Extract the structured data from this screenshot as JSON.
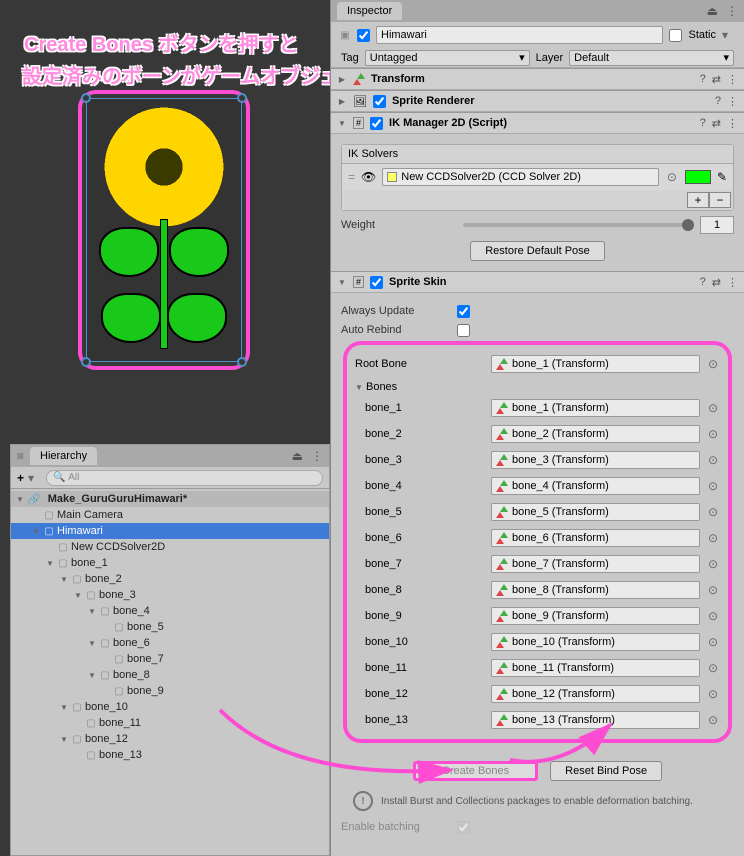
{
  "annot": {
    "line1": "Create Bones ボタンを押すと",
    "line2": "設定済みのボーンがゲームオブジェクトとして追加されました。"
  },
  "hierarchy": {
    "tab": "Hierarchy",
    "plus": "+",
    "search_placeholder": "All",
    "scene": "Make_GuruGuruHimawari*",
    "items": [
      {
        "name": "Main Camera",
        "indent": 1,
        "fold": ""
      },
      {
        "name": "Himawari",
        "indent": 1,
        "fold": "▼",
        "sel": true
      },
      {
        "name": "New CCDSolver2D",
        "indent": 2,
        "fold": ""
      },
      {
        "name": "bone_1",
        "indent": 2,
        "fold": "▼"
      },
      {
        "name": "bone_2",
        "indent": 3,
        "fold": "▼"
      },
      {
        "name": "bone_3",
        "indent": 4,
        "fold": "▼"
      },
      {
        "name": "bone_4",
        "indent": 5,
        "fold": "▼"
      },
      {
        "name": "bone_5",
        "indent": 6,
        "fold": ""
      },
      {
        "name": "bone_6",
        "indent": 5,
        "fold": "▼"
      },
      {
        "name": "bone_7",
        "indent": 6,
        "fold": ""
      },
      {
        "name": "bone_8",
        "indent": 5,
        "fold": "▼"
      },
      {
        "name": "bone_9",
        "indent": 6,
        "fold": ""
      },
      {
        "name": "bone_10",
        "indent": 3,
        "fold": "▼"
      },
      {
        "name": "bone_11",
        "indent": 4,
        "fold": ""
      },
      {
        "name": "bone_12",
        "indent": 3,
        "fold": "▼"
      },
      {
        "name": "bone_13",
        "indent": 4,
        "fold": ""
      }
    ]
  },
  "inspector": {
    "tab": "Inspector",
    "obj_name": "Himawari",
    "static_label": "Static",
    "tag_label": "Tag",
    "tag_value": "Untagged",
    "layer_label": "Layer",
    "layer_value": "Default",
    "transform": "Transform",
    "sprite_renderer": "Sprite Renderer",
    "ik_manager": {
      "title": "IK Manager 2D (Script)",
      "solvers_label": "IK Solvers",
      "solver_item": "New CCDSolver2D (CCD Solver 2D)",
      "weight_label": "Weight",
      "weight_value": "1",
      "restore_btn": "Restore Default Pose"
    },
    "sprite_skin": {
      "title": "Sprite Skin",
      "always_update": "Always Update",
      "auto_rebind": "Auto Rebind",
      "root_bone_label": "Root Bone",
      "root_bone_value": "bone_1 (Transform)",
      "bones_label": "Bones",
      "bones": [
        {
          "label": "bone_1",
          "val": "bone_1 (Transform)"
        },
        {
          "label": "bone_2",
          "val": "bone_2 (Transform)"
        },
        {
          "label": "bone_3",
          "val": "bone_3 (Transform)"
        },
        {
          "label": "bone_4",
          "val": "bone_4 (Transform)"
        },
        {
          "label": "bone_5",
          "val": "bone_5 (Transform)"
        },
        {
          "label": "bone_6",
          "val": "bone_6 (Transform)"
        },
        {
          "label": "bone_7",
          "val": "bone_7 (Transform)"
        },
        {
          "label": "bone_8",
          "val": "bone_8 (Transform)"
        },
        {
          "label": "bone_9",
          "val": "bone_9 (Transform)"
        },
        {
          "label": "bone_10",
          "val": "bone_10 (Transform)"
        },
        {
          "label": "bone_11",
          "val": "bone_11 (Transform)"
        },
        {
          "label": "bone_12",
          "val": "bone_12 (Transform)"
        },
        {
          "label": "bone_13",
          "val": "bone_13 (Transform)"
        }
      ],
      "create_bones_btn": "Create Bones",
      "reset_bind_btn": "Reset Bind Pose",
      "info_msg": "Install Burst and Collections packages to enable deformation batching.",
      "enable_batching": "Enable batching"
    }
  }
}
